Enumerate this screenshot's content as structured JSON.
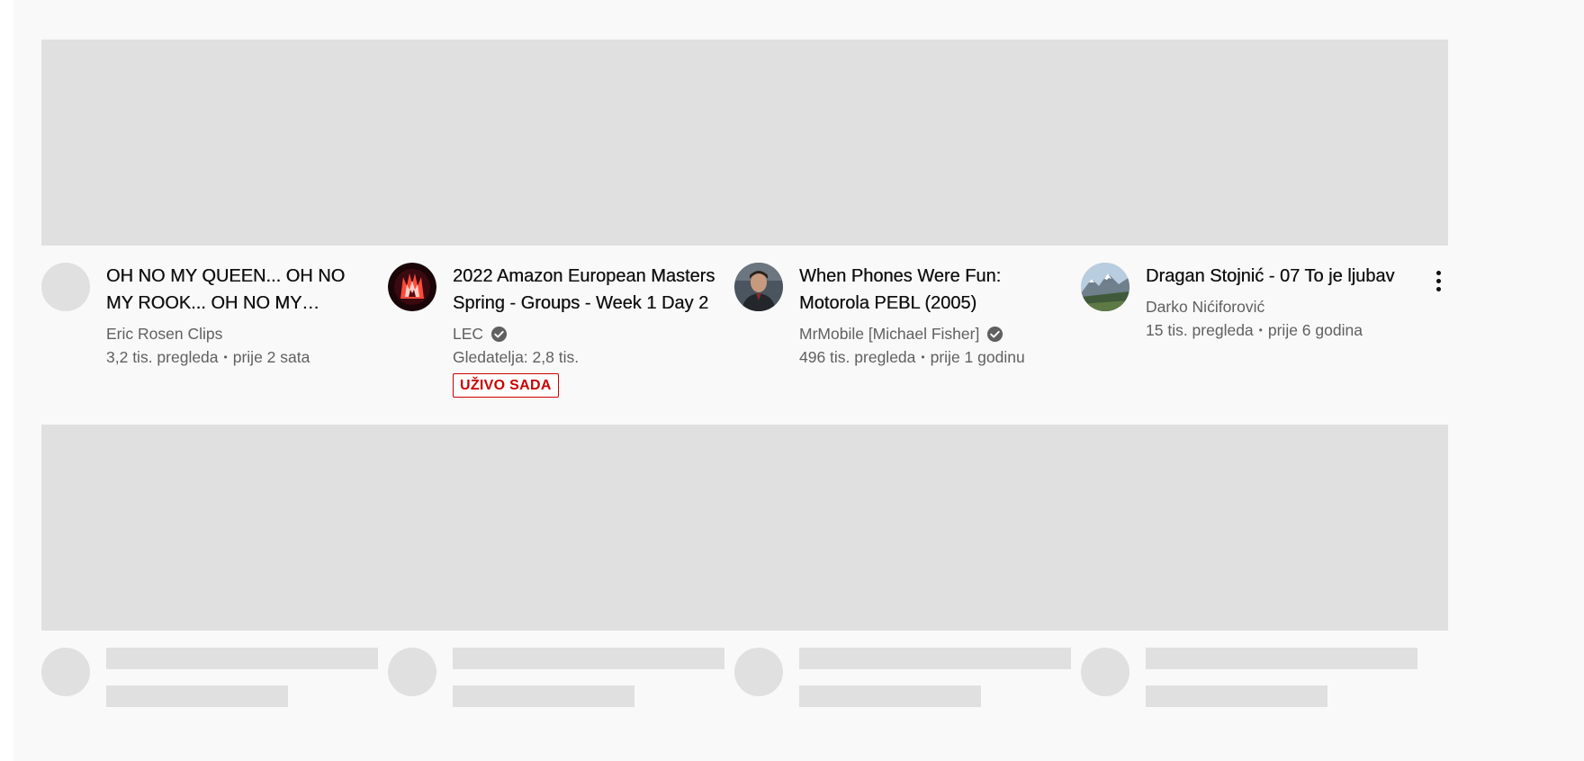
{
  "videos": [
    {
      "title": "OH NO MY QUEEN... OH NO MY ROOK... OH NO MY KNIGHT...",
      "channel": "Eric Rosen Clips",
      "verified": false,
      "views": "3,2 tis. pregleda",
      "age": "prije 2 sata",
      "avatar_icon": "blank-avatar",
      "menu_icon": "more-vertical-icon"
    },
    {
      "title": "2022 Amazon European Masters Spring - Groups - Week 1 Day 2",
      "channel": "LEC",
      "verified": true,
      "viewers": "Gledatelja: 2,8 tis.",
      "live_badge": "UŽIVO SADA",
      "avatar_icon": "lec-logo-icon",
      "menu_icon": "more-vertical-icon"
    },
    {
      "title": "When Phones Were Fun: Motorola PEBL (2005)",
      "channel": "MrMobile [Michael Fisher]",
      "verified": true,
      "views": "496 tis. pregleda",
      "age": "prije 1 godinu",
      "avatar_icon": "person-avatar",
      "menu_icon": "more-vertical-icon"
    },
    {
      "title": "Dragan Stojnić - 07 To je ljubav",
      "channel": "Darko Nićiforović",
      "verified": false,
      "views": "15 tis. pregleda",
      "age": "prije 6 godina",
      "avatar_icon": "mountain-landscape-avatar",
      "menu_icon": "more-vertical-icon"
    }
  ],
  "separator": "•",
  "colors": {
    "background": "#f9f9f9",
    "placeholder": "#e0e0e0",
    "title_text": "#0f0f0f",
    "secondary_text": "#606060",
    "live_red": "#cc0000"
  }
}
